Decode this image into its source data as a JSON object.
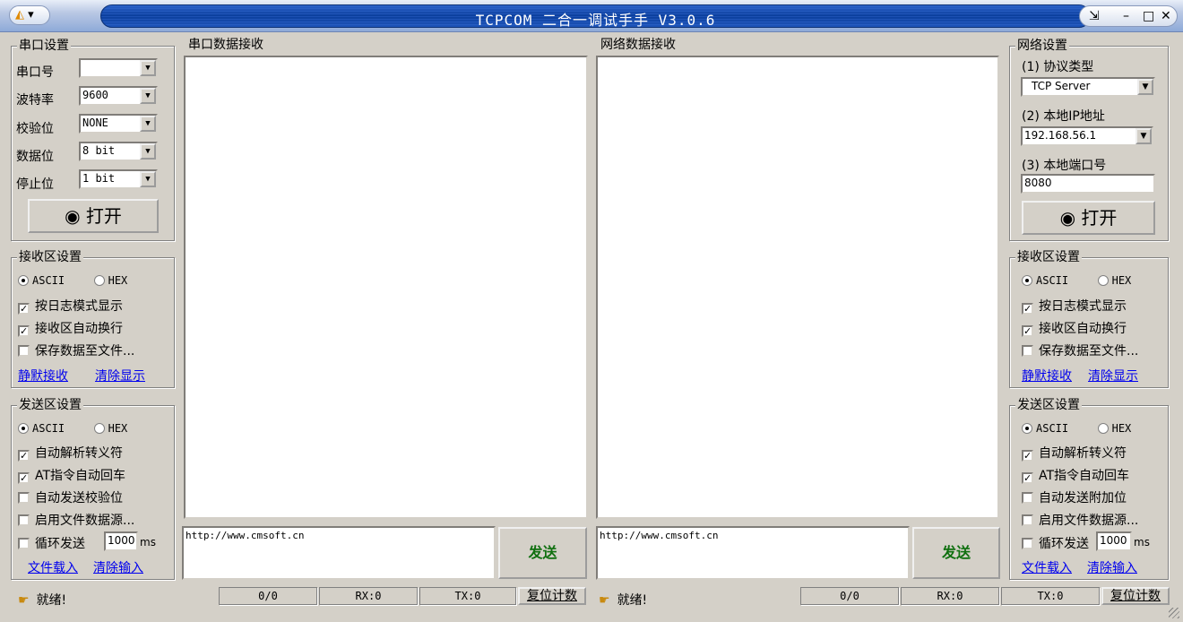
{
  "window": {
    "title": "TCPCOM 二合一调试手手 V3.0.6"
  },
  "serial_settings": {
    "title": "串口设置",
    "port_label": "串口号",
    "port_value": "",
    "baud_label": "波特率",
    "baud_value": "9600",
    "parity_label": "校验位",
    "parity_value": "NONE",
    "databits_label": "数据位",
    "databits_value": "8 bit",
    "stopbits_label": "停止位",
    "stopbits_value": "1 bit",
    "open_label": "◉ 打开"
  },
  "serial_recv_settings": {
    "title": "接收区设置",
    "ascii": "ASCII",
    "hex": "HEX",
    "log_mode": "按日志模式显示",
    "auto_wrap": "接收区自动换行",
    "save_file": "保存数据至文件...",
    "mute_link": "静默接收",
    "clear_link": "清除显示"
  },
  "serial_send_settings": {
    "title": "发送区设置",
    "ascii": "ASCII",
    "hex": "HEX",
    "escape": "自动解析转义符",
    "at_cr": "AT指令自动回车",
    "checksum": "自动发送校验位",
    "file_source": "启用文件数据源...",
    "loop": "循环发送",
    "loop_value": "1000",
    "loop_unit": "ms",
    "load_link": "文件载入",
    "clear_link": "清除输入"
  },
  "serial_panel": {
    "title": "串口数据接收",
    "send_text": "http://www.cmsoft.cn",
    "send_button": "发送"
  },
  "net_panel": {
    "title": "网络数据接收",
    "send_text": "http://www.cmsoft.cn",
    "send_button": "发送"
  },
  "net_settings": {
    "title": "网络设置",
    "protocol_label": "(1) 协议类型",
    "protocol_value": "TCP Server",
    "ip_label": "(2) 本地IP地址",
    "ip_value": "192.168.56.1",
    "port_label": "(3) 本地端口号",
    "port_value": "8080",
    "open_label": "◉ 打开"
  },
  "net_recv_settings": {
    "title": "接收区设置",
    "ascii": "ASCII",
    "hex": "HEX",
    "log_mode": "按日志模式显示",
    "auto_wrap": "接收区自动换行",
    "save_file": "保存数据至文件...",
    "mute_link": "静默接收",
    "clear_link": "清除显示"
  },
  "net_send_settings": {
    "title": "发送区设置",
    "ascii": "ASCII",
    "hex": "HEX",
    "escape": "自动解析转义符",
    "at_cr": "AT指令自动回车",
    "append": "自动发送附加位",
    "file_source": "启用文件数据源...",
    "loop": "循环发送",
    "loop_value": "1000",
    "loop_unit": "ms",
    "load_link": "文件载入",
    "clear_link": "清除输入"
  },
  "status": {
    "left_ready": "就绪!",
    "left_count": "0/0",
    "left_rx": "RX:0",
    "left_tx": "TX:0",
    "left_reset": "复位计数",
    "right_ready": "就绪!",
    "right_count": "0/0",
    "right_rx": "RX:0",
    "right_tx": "TX:0",
    "right_reset": "复位计数"
  }
}
